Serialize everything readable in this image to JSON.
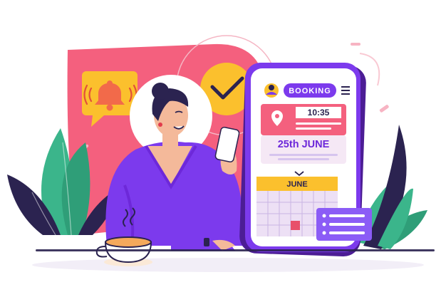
{
  "booking_app": {
    "header": {
      "title": "BOOKING",
      "avatar_icon": "user-avatar-icon",
      "menu_icon": "hamburger-menu-icon"
    },
    "appointment": {
      "time": "10:35",
      "date": "25th JUNE",
      "location_icon": "map-pin-icon"
    },
    "calendar": {
      "month": "JUNE",
      "chevron_icon": "chevron-down-icon",
      "selected_highlight": "#e8506a"
    }
  },
  "notifications": {
    "bell_icon": "bell-icon",
    "confirm_icon": "checkmark-icon"
  },
  "colors": {
    "purple": "#6d28d9",
    "violet_card": "#8b5cf6",
    "pink": "#f0557a",
    "yellow": "#fbc02d",
    "green": "#3bb58b",
    "dark_navy": "#2b2350"
  }
}
